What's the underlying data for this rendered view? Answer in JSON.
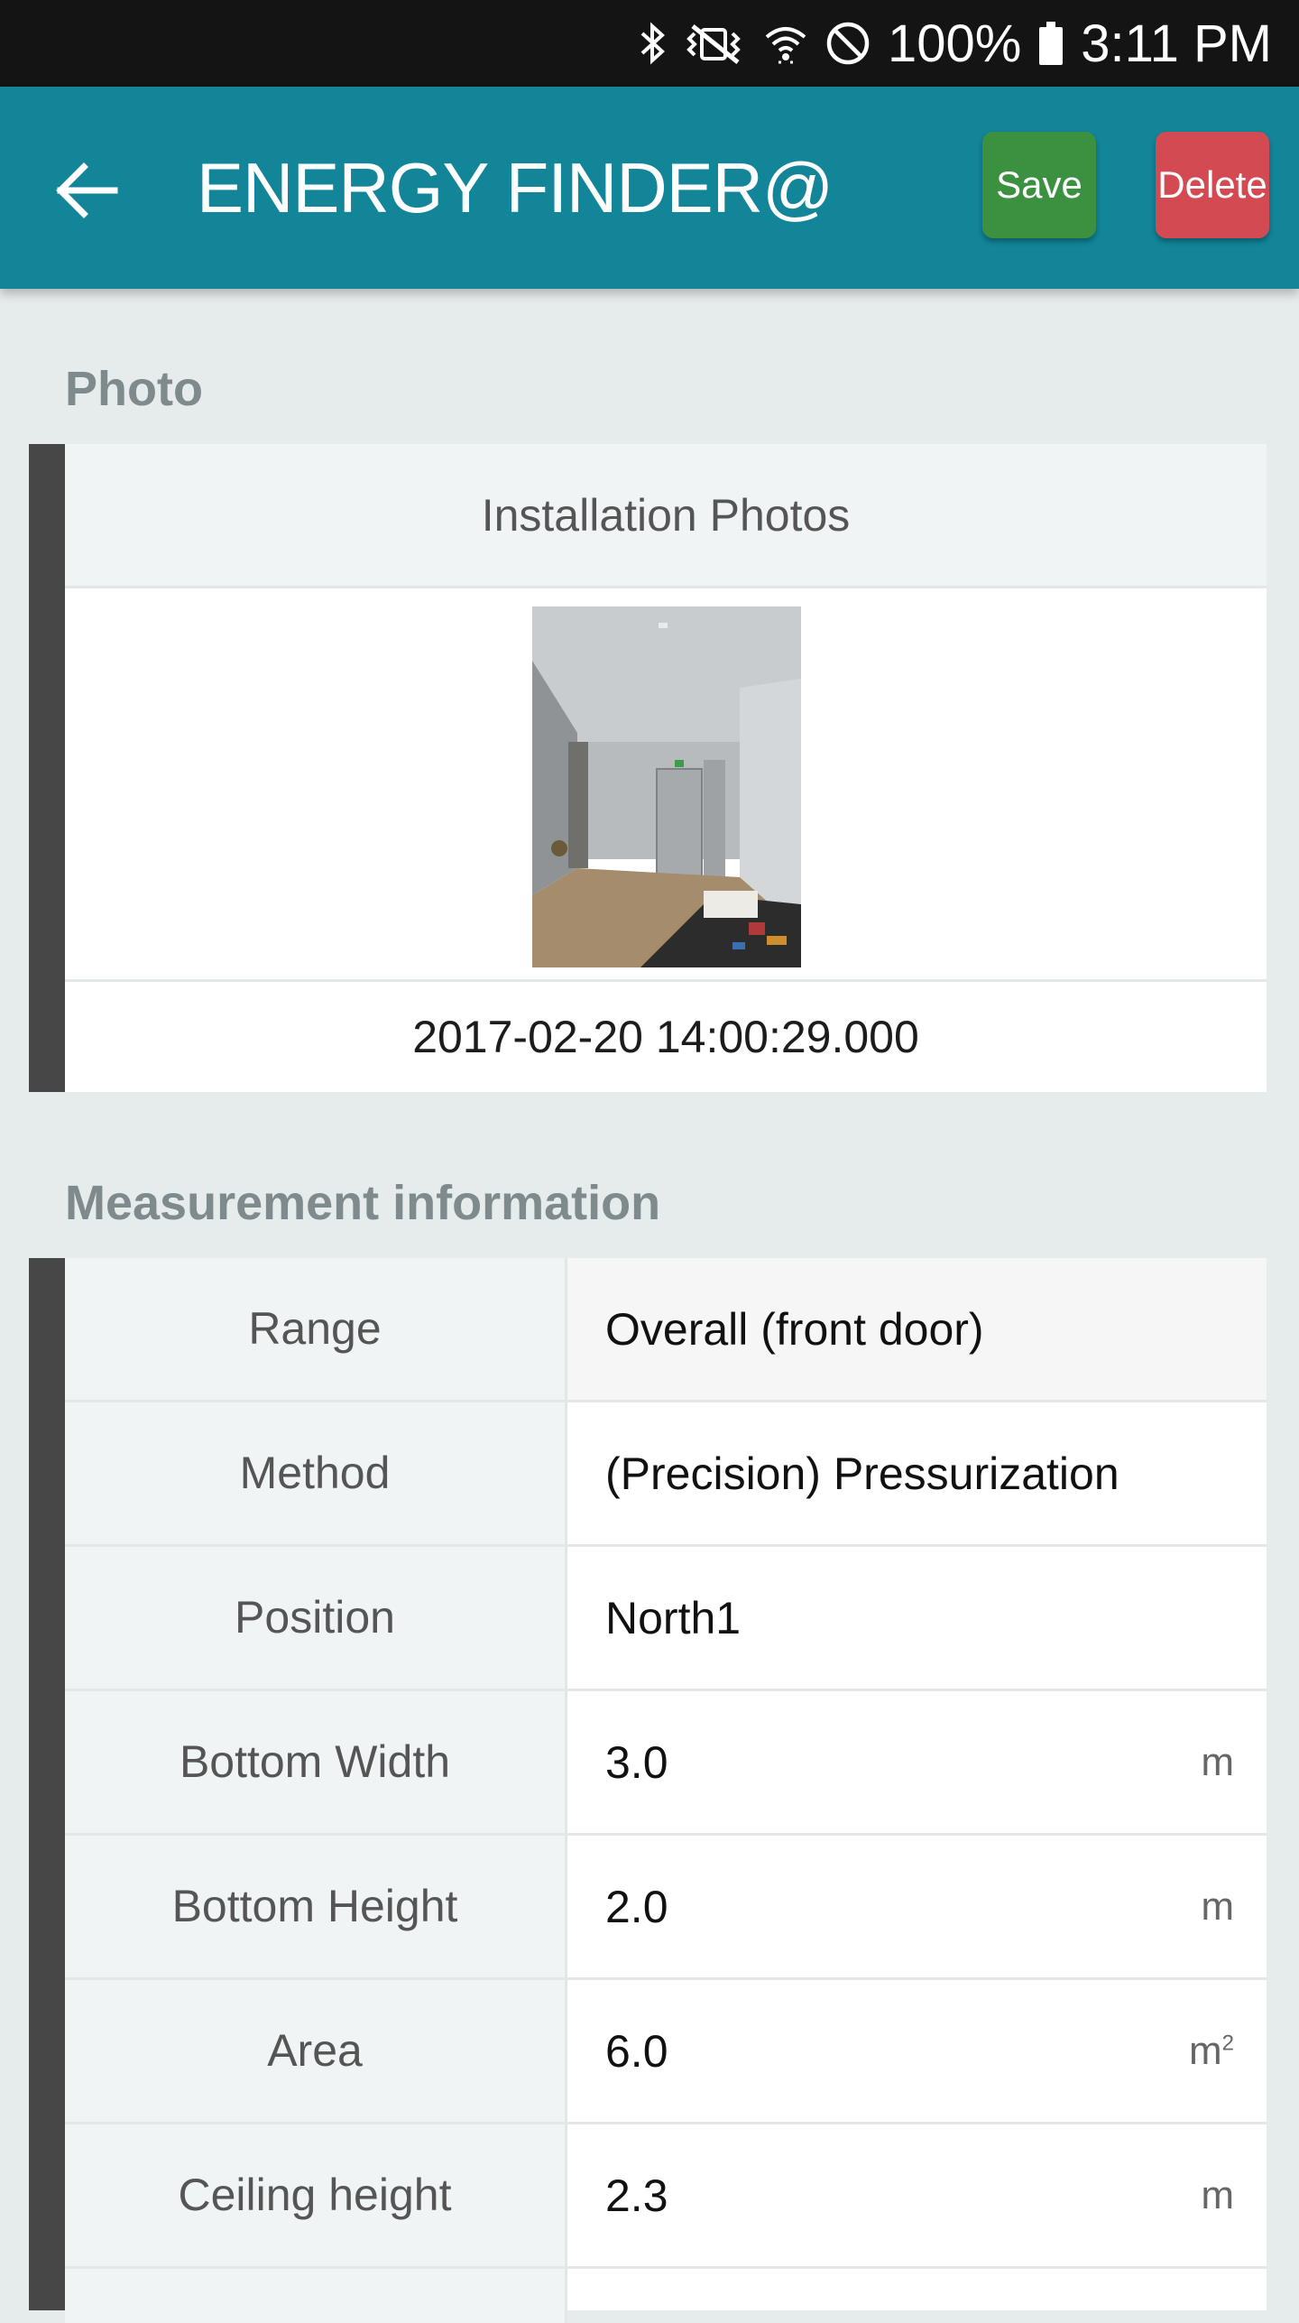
{
  "status_bar": {
    "battery": "100%",
    "time": "3:11 PM",
    "icons": [
      "bluetooth-icon",
      "vibrate-icon",
      "wifi-icon",
      "do-not-disturb-icon",
      "battery-icon"
    ]
  },
  "app_bar": {
    "title": "ENERGY FINDER@",
    "save_label": "Save",
    "delete_label": "Delete",
    "colors": {
      "app_bar": "#128599",
      "save": "#3c9140",
      "delete": "#d44a52"
    }
  },
  "photo_section": {
    "title": "Photo",
    "card_header": "Installation Photos",
    "timestamp": "2017-02-20 14:00:29.000"
  },
  "measurement_section": {
    "title": "Measurement information",
    "rows": [
      {
        "label": "Range",
        "value": "Overall (front door)",
        "unit": ""
      },
      {
        "label": "Method",
        "value": "(Precision) Pressurization",
        "unit": ""
      },
      {
        "label": "Position",
        "value": "North1",
        "unit": ""
      },
      {
        "label": "Bottom Width",
        "value": "3.0",
        "unit": "m"
      },
      {
        "label": "Bottom Height",
        "value": "2.0",
        "unit": "m"
      },
      {
        "label": "Area",
        "value": "6.0",
        "unit": "m",
        "unit_sup": "2"
      },
      {
        "label": "Ceiling height",
        "value": "2.3",
        "unit": "m"
      }
    ]
  }
}
